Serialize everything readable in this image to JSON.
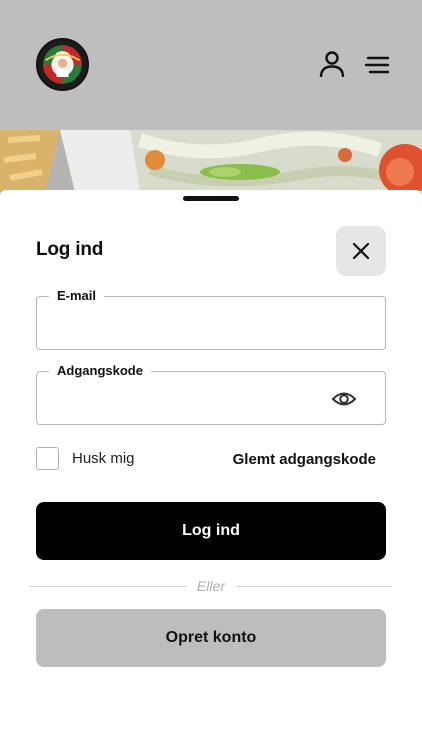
{
  "header": {
    "logo": "restaurant-logo",
    "icons": {
      "user": "user-icon",
      "menu": "hamburger-menu-icon"
    }
  },
  "login": {
    "title": "Log ind",
    "close_icon": "close-icon",
    "email": {
      "label": "E-mail",
      "value": "",
      "placeholder": ""
    },
    "password": {
      "label": "Adgangskode",
      "value": "",
      "placeholder": "",
      "toggle_icon": "eye-icon"
    },
    "remember_label": "Husk mig",
    "remember_checked": false,
    "forgot_label": "Glemt adgangskode",
    "submit_label": "Log ind",
    "divider_label": "Eller",
    "signup_label": "Opret konto"
  },
  "colors": {
    "header_bg": "#bebebe",
    "primary_button": "#000000",
    "secondary_button": "#bdbdbd"
  }
}
